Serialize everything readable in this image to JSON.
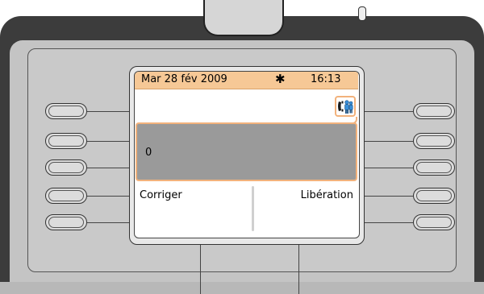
{
  "status_bar": {
    "date": "Mar 28 fév 2009",
    "weather_icon": "sun-icon",
    "time": "16:13"
  },
  "input": {
    "value": "0"
  },
  "call_indicator_icon": "handset-with-people-icon",
  "softkeys": {
    "left_label": "Corriger",
    "right_label": "Libération"
  },
  "colors": {
    "status_bar_bg": "#f6c896",
    "accent_orange": "#f2b27c",
    "input_bg": "#9a9a9a",
    "phone_body": "#3c3c3c",
    "panel": "#c4c4c4"
  }
}
